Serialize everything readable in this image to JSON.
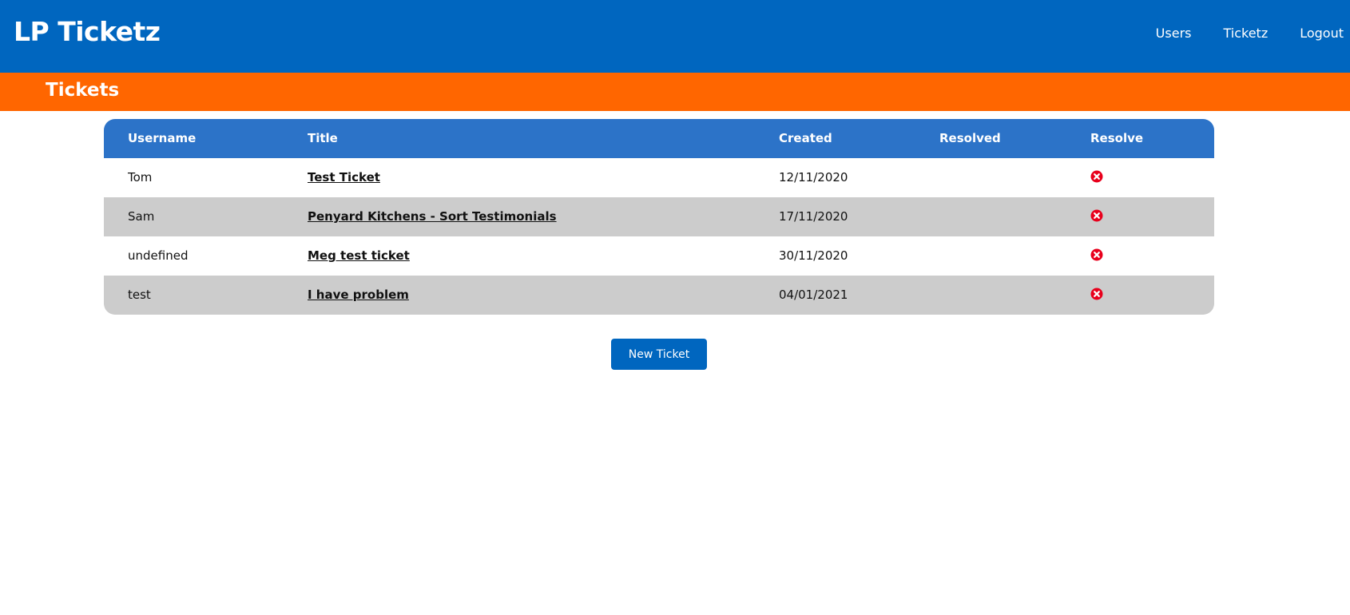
{
  "colors": {
    "nav_bg": "#0066bf",
    "subheader_bg": "#ff6600",
    "table_header_bg": "#2c73c8",
    "row_alt_bg": "#cccccc",
    "resolve_icon": "#e8001c"
  },
  "navbar": {
    "brand": "LP Ticketz",
    "links": [
      {
        "label": "Users"
      },
      {
        "label": "Ticketz"
      },
      {
        "label": "Logout"
      }
    ]
  },
  "subheader": {
    "title": "Tickets"
  },
  "table": {
    "columns": [
      "Username",
      "Title",
      "Created",
      "Resolved",
      "Resolve"
    ],
    "rows": [
      {
        "username": "Tom",
        "title": "Test Ticket",
        "created": "12/11/2020",
        "resolved": "",
        "resolve_icon": "close-circle-icon"
      },
      {
        "username": "Sam",
        "title": "Penyard Kitchens - Sort Testimonials",
        "created": "17/11/2020",
        "resolved": "",
        "resolve_icon": "close-circle-icon"
      },
      {
        "username": "undefined",
        "title": "Meg test ticket",
        "created": "30/11/2020",
        "resolved": "",
        "resolve_icon": "close-circle-icon"
      },
      {
        "username": "test",
        "title": "I have problem",
        "created": "04/01/2021",
        "resolved": "",
        "resolve_icon": "close-circle-icon"
      }
    ]
  },
  "actions": {
    "new_ticket_label": "New Ticket"
  }
}
